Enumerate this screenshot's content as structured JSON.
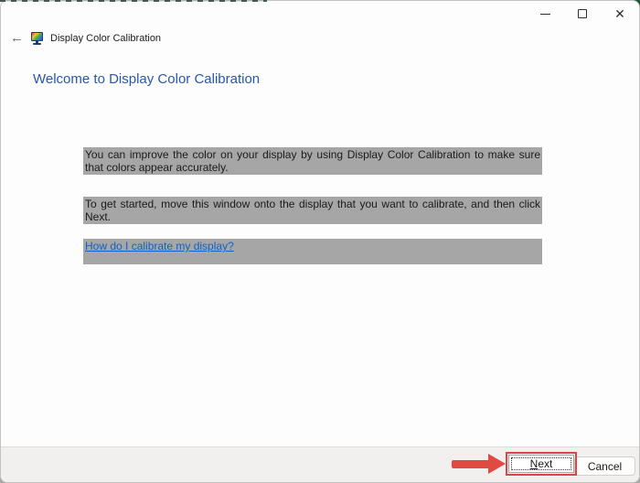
{
  "titlebar": {
    "close_glyph": "✕"
  },
  "nav": {
    "back_glyph": "←",
    "app_title": "Display Color Calibration"
  },
  "main": {
    "heading": "Welcome to Display Color Calibration",
    "paragraphs": [
      "You can improve the color on your display by using Display Color Calibration to make sure that colors appear accurately.",
      "To get started, move this window onto the display that you want to calibrate, and then click Next."
    ],
    "help_link": "How do I calibrate my display?"
  },
  "footer": {
    "next_button": {
      "access_key": "N",
      "rest": "ext"
    },
    "cancel_label": "Cancel"
  },
  "annotation": {
    "arrow_icon": "red-arrow-pointing-right",
    "box": "red-highlight-box-around-next"
  },
  "colors": {
    "highlight_gray": "#a6a6a6",
    "heading_blue": "#2757ad",
    "link_blue": "#0b63cb",
    "annotation_red": "#df4a43",
    "footer_bg": "#f1f0ee",
    "corner_green": "#1c5939"
  }
}
